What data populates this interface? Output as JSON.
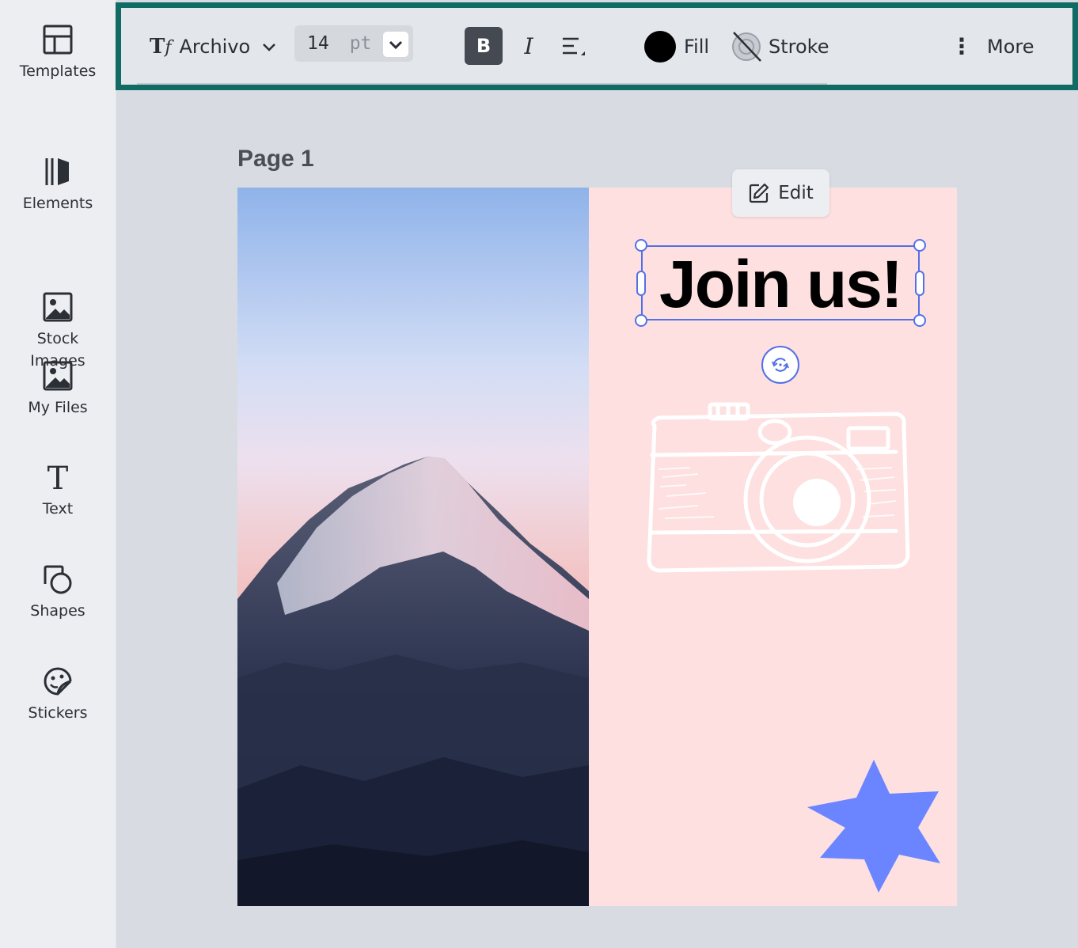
{
  "sidebar": {
    "items": [
      {
        "label": "Templates",
        "icon": "templates-icon"
      },
      {
        "label": "Elements",
        "icon": "elements-icon"
      },
      {
        "label": "Stock\nImages",
        "icon": "image-icon"
      },
      {
        "label": "My Files",
        "icon": "image-icon"
      },
      {
        "label": "Text",
        "icon": "text-icon"
      },
      {
        "label": "Shapes",
        "icon": "shapes-icon"
      },
      {
        "label": "Stickers",
        "icon": "sticker-icon"
      }
    ]
  },
  "toolbar": {
    "font_icon_text": "T",
    "font_icon_sub": "f",
    "font_name": "Archivo",
    "font_size": "14",
    "font_size_unit": "pt",
    "bold_label": "B",
    "italic_label": "I",
    "fill_label": "Fill",
    "fill_color": "#000000",
    "stroke_label": "Stroke",
    "more_label": "More",
    "more_glyph": "⋮",
    "accent": "#0f6b63"
  },
  "canvas": {
    "page_label": "Page 1",
    "edit_label": "Edit",
    "headline": "Join us!",
    "background": "#fde0df",
    "selection_color": "#5470e8",
    "star_color": "#6a85ff"
  }
}
